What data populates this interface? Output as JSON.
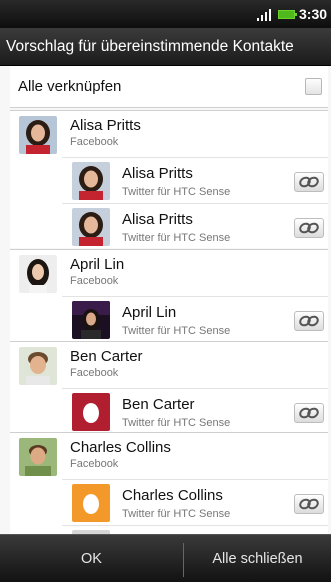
{
  "status_bar": {
    "time": "3:30",
    "signal_icon": "signal-bars-icon",
    "battery_icon": "battery-icon"
  },
  "title": "Vorschlag für übereinstimmende Kontakte",
  "link_all": {
    "label": "Alle verknüpfen",
    "checked": false
  },
  "groups": [
    {
      "name": "Alisa Pritts",
      "source": "Facebook",
      "matches": [
        {
          "name": "Alisa Pritts",
          "source": "Twitter für HTC Sense"
        },
        {
          "name": "Alisa Pritts",
          "source": "Twitter für HTC Sense"
        }
      ]
    },
    {
      "name": "April Lin",
      "source": "Facebook",
      "matches": [
        {
          "name": "April Lin",
          "source": "Twitter für HTC Sense"
        }
      ]
    },
    {
      "name": "Ben Carter",
      "source": "Facebook",
      "matches": [
        {
          "name": "Ben Carter",
          "source": "Twitter für HTC Sense"
        }
      ]
    },
    {
      "name": "Charles Collins",
      "source": "Facebook",
      "matches": [
        {
          "name": "Charles Collins",
          "source": "Twitter für HTC Sense"
        }
      ]
    }
  ],
  "buttons": {
    "ok": "OK",
    "close_all": "Alle schließen"
  },
  "colors": {
    "accent_link": "#555555",
    "egg_red": "#b11e2f",
    "egg_orange": "#f3992a"
  }
}
